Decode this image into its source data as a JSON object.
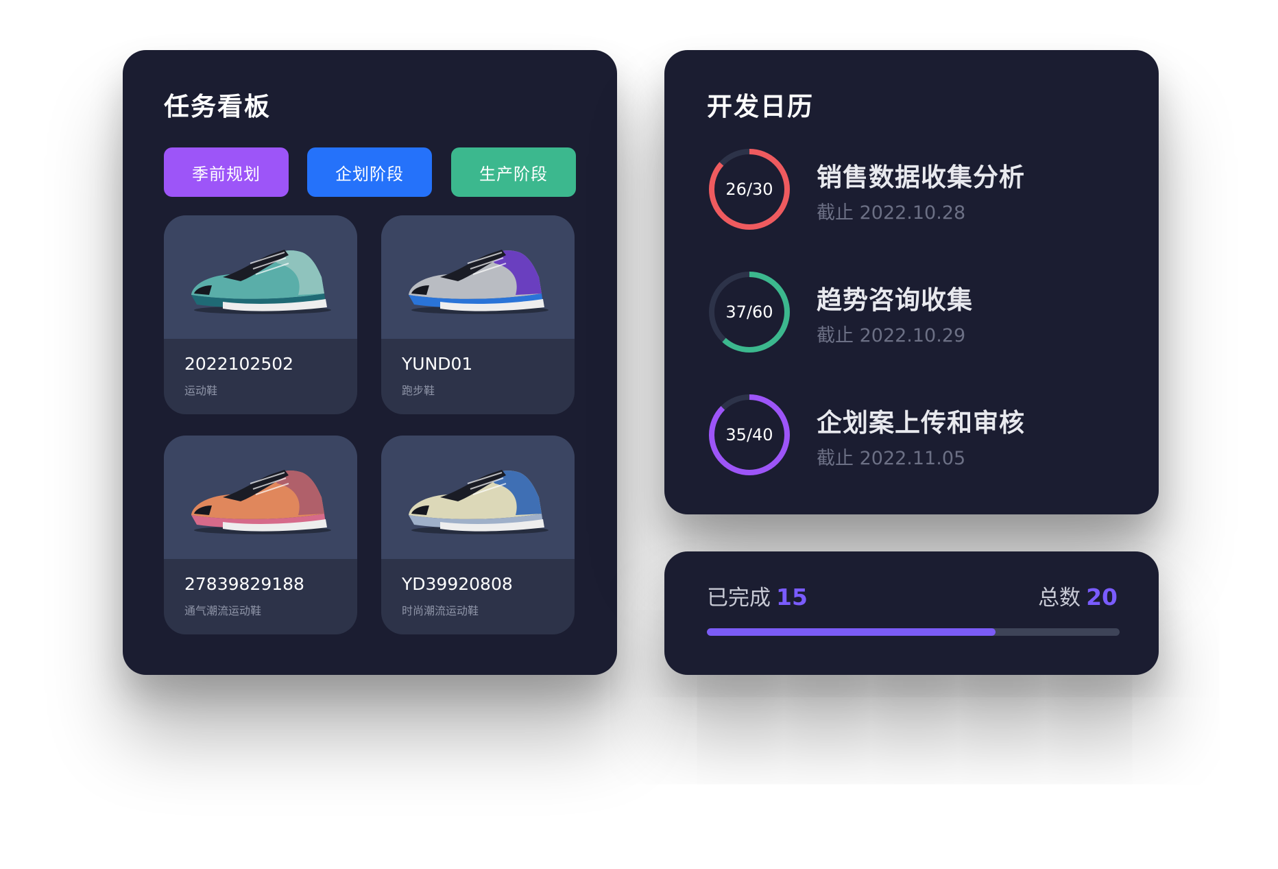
{
  "board": {
    "title": "任务看板",
    "tags": [
      {
        "label": "季前规划",
        "color": "#9d55f8"
      },
      {
        "label": "企划阶段",
        "color": "#2572fa"
      },
      {
        "label": "生产阶段",
        "color": "#3cb88e"
      }
    ],
    "products": [
      {
        "code": "2022102502",
        "type": "运动鞋",
        "colors": [
          "#5aaea9",
          "#8fc3bd",
          "#1f6a75"
        ]
      },
      {
        "code": "YUND01",
        "type": "跑步鞋",
        "colors": [
          "#b9bcc2",
          "#6a3fbf",
          "#2a74d8"
        ]
      },
      {
        "code": "27839829188",
        "type": "通气潮流运动鞋",
        "colors": [
          "#e0875c",
          "#b0606a",
          "#d66a8a"
        ]
      },
      {
        "code": "YD39920808",
        "type": "时尚潮流运动鞋",
        "colors": [
          "#dcd8b8",
          "#3f6fb4",
          "#9fb0c9"
        ]
      }
    ]
  },
  "calendar": {
    "title": "开发日历",
    "tasks": [
      {
        "name": "销售数据收集分析",
        "due": "截止 2022.10.28",
        "progress_label": "26/30",
        "done": 26,
        "total": 30,
        "color": "#ef5b5f"
      },
      {
        "name": "趋势咨询收集",
        "due": "截止 2022.10.29",
        "progress_label": "37/60",
        "done": 37,
        "total": 60,
        "color": "#3cb88e"
      },
      {
        "name": "企划案上传和审核",
        "due": "截止 2022.11.05",
        "progress_label": "35/40",
        "done": 35,
        "total": 40,
        "color": "#9d55f8"
      }
    ]
  },
  "summary": {
    "completed_label": "已完成",
    "completed_value": "15",
    "total_label": "总数",
    "total_value": "20",
    "fraction": 0.7,
    "accent": "#7b5cf6"
  }
}
